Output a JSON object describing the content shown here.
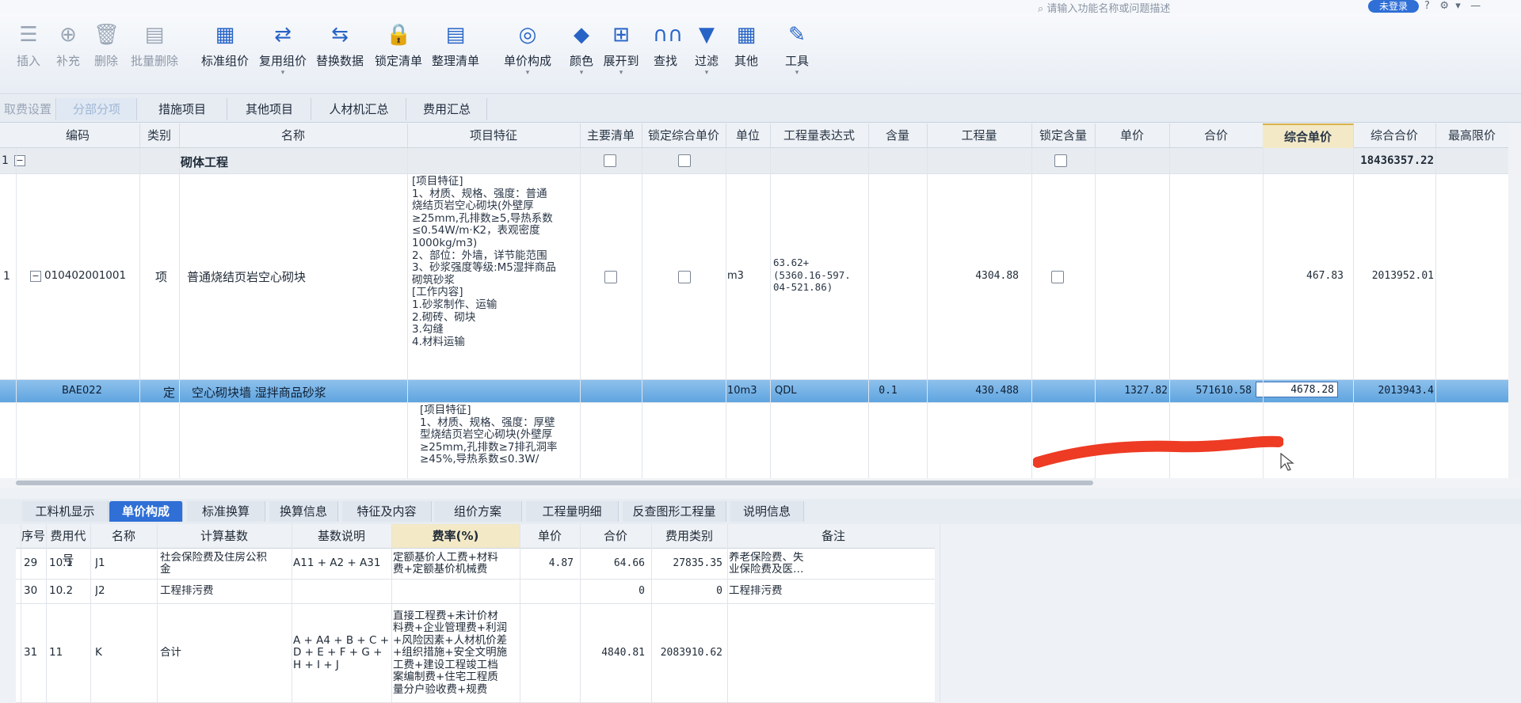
{
  "topbar": {
    "search_placeholder": "请输入功能名称或问题描述",
    "login_label": "未登录"
  },
  "toolbar": {
    "items": [
      {
        "label": "插入",
        "icon": "insert-icon",
        "dim": true
      },
      {
        "label": "补充",
        "icon": "supplement-icon",
        "dim": true
      },
      {
        "label": "删除",
        "icon": "trash-icon",
        "dim": true
      },
      {
        "label": "批量删除",
        "icon": "batch-delete-icon",
        "dim": true
      },
      {
        "label": "标准组价",
        "icon": "standard-price-icon"
      },
      {
        "label": "复用组价",
        "icon": "reuse-price-icon"
      },
      {
        "label": "替换数据",
        "icon": "replace-data-icon"
      },
      {
        "label": "锁定清单",
        "icon": "lock-icon"
      },
      {
        "label": "整理清单",
        "icon": "organize-list-icon"
      },
      {
        "label": "单价构成",
        "icon": "price-composition-icon"
      },
      {
        "label": "颜色",
        "icon": "color-bucket-icon"
      },
      {
        "label": "展开到",
        "icon": "expand-icon"
      },
      {
        "label": "查找",
        "icon": "binoculars-icon"
      },
      {
        "label": "过滤",
        "icon": "filter-icon"
      },
      {
        "label": "其他",
        "icon": "grid-icon"
      },
      {
        "label": "工具",
        "icon": "tools-icon"
      }
    ]
  },
  "tabs": [
    {
      "label": "取费设置"
    },
    {
      "label": "分部分项"
    },
    {
      "label": "措施项目"
    },
    {
      "label": "其他项目"
    },
    {
      "label": "人材机汇总"
    },
    {
      "label": "费用汇总"
    }
  ],
  "grid": {
    "headers": [
      "编码",
      "类别",
      "名称",
      "项目特征",
      "主要清单",
      "锁定综合单价",
      "单位",
      "工程量表达式",
      "含量",
      "工程量",
      "锁定含量",
      "单价",
      "合价",
      "综合单价",
      "综合合价",
      "最高限价"
    ],
    "group_row": {
      "index": "1",
      "name": "砌体工程",
      "total": "18436357.22"
    },
    "item_row": {
      "index": "1",
      "code": "010402001001",
      "type": "项",
      "name": "普通烧结页岩空心砌块",
      "feature_lines": [
        "[项目特征]",
        "1、材质、规格、强度：普通",
        "烧结页岩空心砌块(外壁厚",
        "≥25mm,孔排数≥5,导热系数",
        "≤0.54W/m·K2，表观密度",
        "1000kg/m3)",
        "2、部位：外墙，详节能范围",
        "3、砂浆强度等级:M5湿拌商品",
        "砌筑砂浆",
        "[工作内容]",
        "1.砂浆制作、运输",
        "2.砌砖、砌块",
        "3.勾缝",
        "4.材料运输"
      ],
      "unit": "m3",
      "expr_lines": [
        "63.62+",
        "(5360.16-597.",
        "04-521.86)"
      ],
      "quantity": "4304.88",
      "comp_price": "467.83",
      "comp_total": "2013952.01"
    },
    "sel_row": {
      "code": "BAE022",
      "type": "定",
      "name": "空心砌块墙 湿拌商品砂浆",
      "unit": "10m3",
      "expr": "QDL",
      "content": "0.1",
      "quantity": "430.488",
      "price": "1327.82",
      "total": "571610.58",
      "comp_price": "4678.28",
      "comp_total": "2013943.4"
    },
    "partial_row": {
      "feature_lines": [
        "[项目特征]",
        "1、材质、规格、强度：厚壁",
        "型烧结页岩空心砌块(外壁厚",
        "≥25mm,孔排数≥7排孔洞率",
        "≥45%,导热系数≤0.3W/"
      ]
    }
  },
  "bottom_tabs": [
    {
      "label": "工料机显示"
    },
    {
      "label": "单价构成"
    },
    {
      "label": "标准换算"
    },
    {
      "label": "换算信息"
    },
    {
      "label": "特征及内容"
    },
    {
      "label": "组价方案"
    },
    {
      "label": "工程量明细"
    },
    {
      "label": "反查图形工程量"
    },
    {
      "label": "说明信息"
    }
  ],
  "bottom_table": {
    "headers": [
      "序号",
      "费用代号",
      "名称",
      "计算基数",
      "基数说明",
      "费率(%)",
      "单价",
      "合价",
      "费用类别",
      "备注"
    ],
    "rows": [
      {
        "idx": "29",
        "seq": "10.1",
        "code": "J1",
        "name_lines": [
          "社会保险费及住房公积",
          "金"
        ],
        "base_lines": [
          "A11 + A2 + A31"
        ],
        "desc_lines": [
          "定额基价人工费+材料",
          "费+定额基价机械费"
        ],
        "rate": "4.87",
        "price": "64.66",
        "total": "27835.35",
        "cat_lines": [
          "养老保险费、失",
          "业保险费及医…"
        ]
      },
      {
        "idx": "30",
        "seq": "10.2",
        "code": "J2",
        "name_lines": [
          "工程排污费"
        ],
        "base_lines": [
          ""
        ],
        "desc_lines": [
          ""
        ],
        "rate": "",
        "price": "0",
        "total": "0",
        "cat_lines": [
          "工程排污费"
        ]
      },
      {
        "idx": "31",
        "seq": "11",
        "code": "K",
        "name_lines": [
          "合计"
        ],
        "base_lines": [
          "A + A4 + B + C +",
          "D + E + F + G +",
          "H + I + J"
        ],
        "desc_lines": [
          "直接工程费+未计价材",
          "料费+企业管理费+利润",
          "+风险因素+人材机价差",
          "+组织措施+安全文明施",
          "工费+建设工程竣工档",
          "案编制费+住宅工程质",
          "量分户验收费+规费"
        ],
        "rate": "",
        "price": "4840.81",
        "total": "2083910.62",
        "cat_lines": [
          ""
        ]
      }
    ]
  }
}
